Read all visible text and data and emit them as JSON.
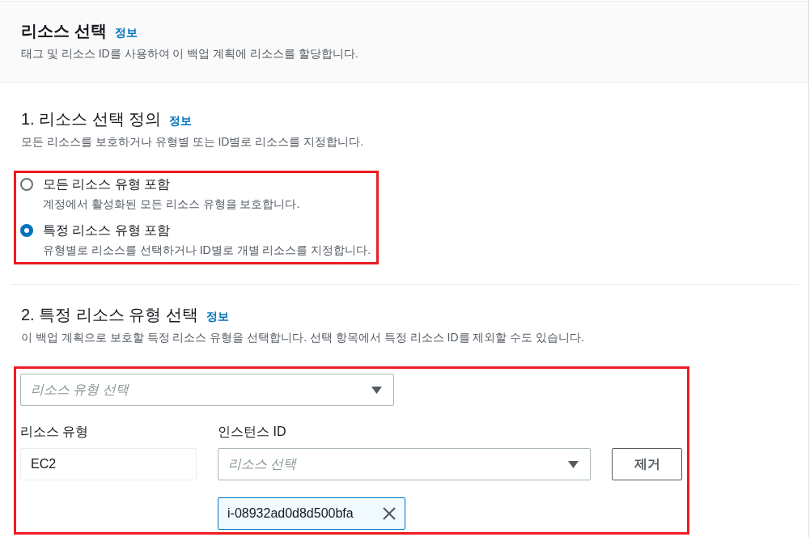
{
  "header": {
    "title": "리소스 선택",
    "info_link": "정보",
    "description": "태그 및 리소스 ID를 사용하여 이 백업 계획에 리소스를 할당합니다."
  },
  "selection_definition": {
    "heading": "1. 리소스 선택 정의",
    "info_link": "정보",
    "description": "모든 리소스를 보호하거나 유형별 또는 ID별로 리소스를 지정합니다.",
    "highlighted": true,
    "options": [
      {
        "label": "모든 리소스 유형 포함",
        "description": "계정에서 활성화된 모든 리소스 유형을 보호합니다.",
        "selected": false
      },
      {
        "label": "특정 리소스 유형 포함",
        "description": "유형별로 리소스를 선택하거나 ID별로 개별 리소스를 지정합니다.",
        "selected": true
      }
    ]
  },
  "resource_type_selection": {
    "heading": "2. 특정 리소스 유형 선택",
    "info_link": "정보",
    "description": "이 백업 계획으로 보호할 특정 리소스 유형을 선택합니다. 선택 항목에서 특정 리소스 ID를 제외할 수도 있습니다.",
    "highlighted": true,
    "type_select": {
      "placeholder": "리소스 유형 선택"
    },
    "rows": [
      {
        "type_label": "리소스 유형",
        "type_value": "EC2",
        "id_label": "인스턴스 ID",
        "id_select": {
          "placeholder": "리소스 선택"
        },
        "remove_button": "제거",
        "tokens": [
          {
            "label": "i-08932ad0d8d500bfa"
          }
        ]
      }
    ]
  }
}
